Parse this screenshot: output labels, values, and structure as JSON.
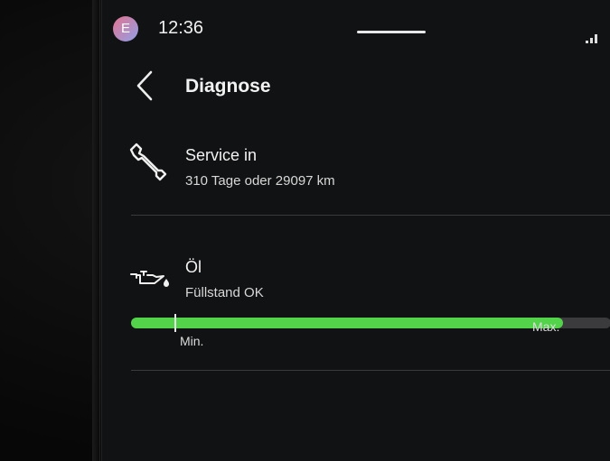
{
  "status_bar": {
    "avatar_letter": "E",
    "time": "12:36",
    "avatar_gradient": [
      "#e3738f",
      "#8fa0e8"
    ]
  },
  "header": {
    "title": "Diagnose",
    "back_icon": "chevron-left-icon"
  },
  "service": {
    "icon": "wrench-icon",
    "title": "Service in",
    "detail": "310 Tage oder 29097 km"
  },
  "oil": {
    "icon": "oil-can-icon",
    "title": "Öl",
    "status": "Füllstand OK",
    "level_fraction": 0.9,
    "min_label": "Min.",
    "max_label": "Max.",
    "fill_color": "#52d34a",
    "track_color": "#3b3b3d"
  }
}
